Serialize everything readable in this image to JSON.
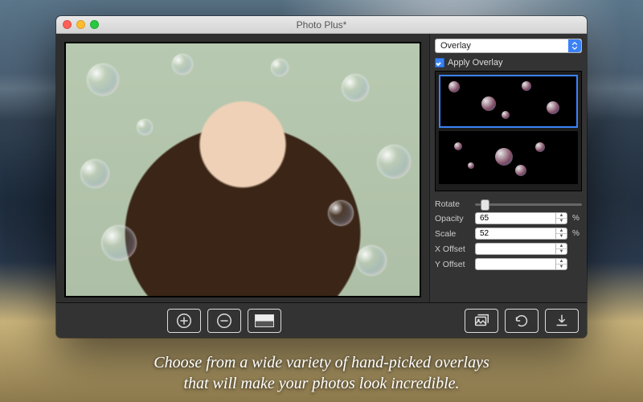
{
  "window": {
    "title": "Photo Plus*"
  },
  "sidebar": {
    "dropdown_label": "Overlay",
    "apply_label": "Apply Overlay",
    "controls": {
      "rotate_label": "Rotate",
      "opacity_label": "Opacity",
      "opacity_value": "65",
      "opacity_suffix": "%",
      "scale_label": "Scale",
      "scale_value": "52",
      "scale_suffix": "%",
      "xoffset_label": "X Offset",
      "xoffset_value": "",
      "yoffset_label": "Y Offset",
      "yoffset_value": ""
    }
  },
  "caption": {
    "line1": "Choose from a wide variety of hand-picked overlays",
    "line2": "that will make your photos look incredible."
  }
}
